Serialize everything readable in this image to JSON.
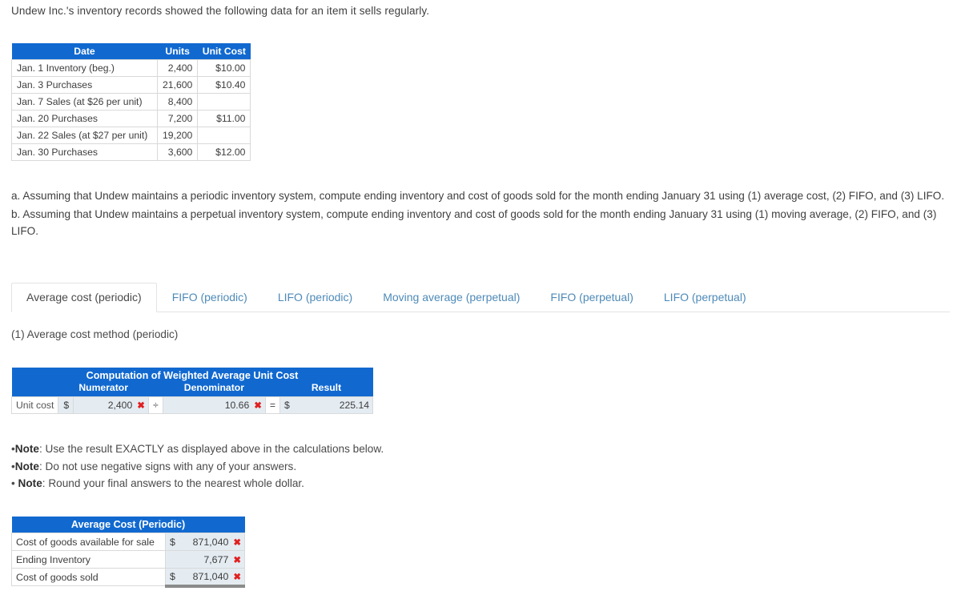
{
  "intro": "Undew Inc.'s inventory records showed the following data for an item it sells regularly.",
  "inventory_table": {
    "headers": {
      "date": "Date",
      "units": "Units",
      "unit_cost": "Unit Cost"
    },
    "rows": [
      {
        "date": "Jan. 1 Inventory (beg.)",
        "units": "2,400",
        "unit_cost": "$10.00"
      },
      {
        "date": "Jan. 3 Purchases",
        "units": "21,600",
        "unit_cost": "$10.40"
      },
      {
        "date": "Jan. 7 Sales (at $26 per unit)",
        "units": "8,400",
        "unit_cost": ""
      },
      {
        "date": "Jan. 20 Purchases",
        "units": "7,200",
        "unit_cost": "$11.00"
      },
      {
        "date": "Jan. 22 Sales (at $27 per unit)",
        "units": "19,200",
        "unit_cost": ""
      },
      {
        "date": "Jan. 30 Purchases",
        "units": "3,600",
        "unit_cost": "$12.00"
      }
    ]
  },
  "question": {
    "a_line1": "a. Assuming that Undew maintains a periodic inventory system, compute ending inventory and cost of goods sold for the month ending January 31 using (1) average cost,",
    "a_line2": "(2) FIFO, and (3) LIFO.",
    "b_line1": "b. Assuming that Undew maintains a perpetual inventory system, compute ending inventory and cost of goods sold for the month ending January 31 using (1) moving",
    "b_line2": "average, (2) FIFO, and (3) LIFO."
  },
  "tabs": {
    "items": [
      {
        "label": "Average cost (periodic)",
        "active": true
      },
      {
        "label": "FIFO (periodic)",
        "active": false
      },
      {
        "label": "LIFO (periodic)",
        "active": false
      },
      {
        "label": "Moving average (perpetual)",
        "active": false
      },
      {
        "label": "FIFO (perpetual)",
        "active": false
      },
      {
        "label": "LIFO (perpetual)",
        "active": false
      }
    ]
  },
  "subheading": "(1) Average cost method (periodic)",
  "computation": {
    "title": "Computation of Weighted Average Unit Cost",
    "col_numerator": "Numerator",
    "col_denominator": "Denominator",
    "col_result": "Result",
    "row_label": "Unit cost",
    "numerator_currency": "$",
    "numerator_value": "2,400",
    "operator_divide": "÷",
    "denominator_value": "10.66",
    "operator_equals": "=",
    "result_currency": "$",
    "result_value": "225.14",
    "error_mark": "✖"
  },
  "notes": {
    "bullet": "•",
    "label": "Note",
    "note1": ": Use the result EXACTLY as displayed above in the calculations below.",
    "note2": ": Do not use negative signs with any of your answers.",
    "note3": ": Round your final answers to the nearest whole dollar."
  },
  "answers": {
    "title": "Average Cost (Periodic)",
    "error_mark": "✖",
    "rows": [
      {
        "label": "Cost of goods available for sale",
        "currency": "$",
        "value": "871,040"
      },
      {
        "label": "Ending Inventory",
        "currency": "",
        "value": "7,677"
      },
      {
        "label": "Cost of goods sold",
        "currency": "$",
        "value": "871,040"
      }
    ]
  },
  "colors": {
    "header_blue": "#1169d0",
    "tab_link": "#4e8ab8",
    "error_red": "#e02020",
    "input_bg": "#e4ecf2"
  }
}
